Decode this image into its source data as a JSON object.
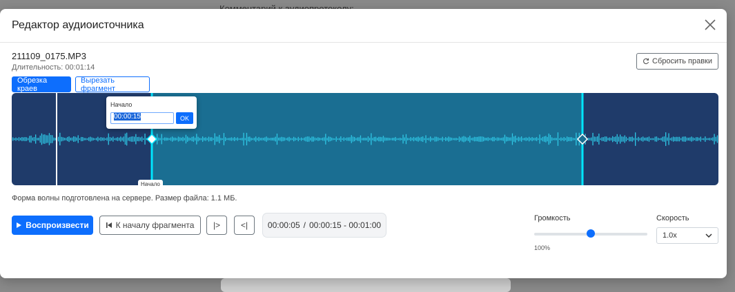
{
  "background": {
    "comment_label": "Комментарий к аудиопротоколу:"
  },
  "modal": {
    "title": "Редактор аудиоисточника",
    "close_icon": "close-icon",
    "file_name": "211109_0175.MP3",
    "duration": "Длительность: 00:01:14",
    "reset_label": "Сбросить правки",
    "reset_icon": "refresh-icon",
    "modes": {
      "trim_label": "Обрезка краев",
      "cut_label": "Вырезать фрагмент",
      "active": "trim"
    },
    "waveform": {
      "popover_label": "Начало",
      "popover_value": "00:00:15",
      "popover_ok": "OK",
      "marker_label": "Начало",
      "colors": {
        "background": "#1f3b6a",
        "selected": "#1a6e92",
        "wave": "#2ec8e6",
        "marker": "#00e5ff",
        "playhead": "#ffffff"
      }
    },
    "info": "Форма волны подготовлена на сервере. Размер файла: 1.1 МБ.",
    "controls": {
      "play_label": "Воспроизвести",
      "play_icon": "play-icon",
      "to_start_label": "К началу фрагмента",
      "to_start_icon": "skip-back-icon",
      "next_label": "|>",
      "prev_label": "<|",
      "time_current": "00:00:05",
      "time_separator": "/",
      "time_range": "00:00:15 - 00:01:00"
    },
    "volume": {
      "label": "Громкость",
      "value_text": "100%",
      "level": 0.5
    },
    "speed": {
      "label": "Скорость",
      "selected": "1.0x"
    },
    "accent_color": "#0d6efd"
  }
}
